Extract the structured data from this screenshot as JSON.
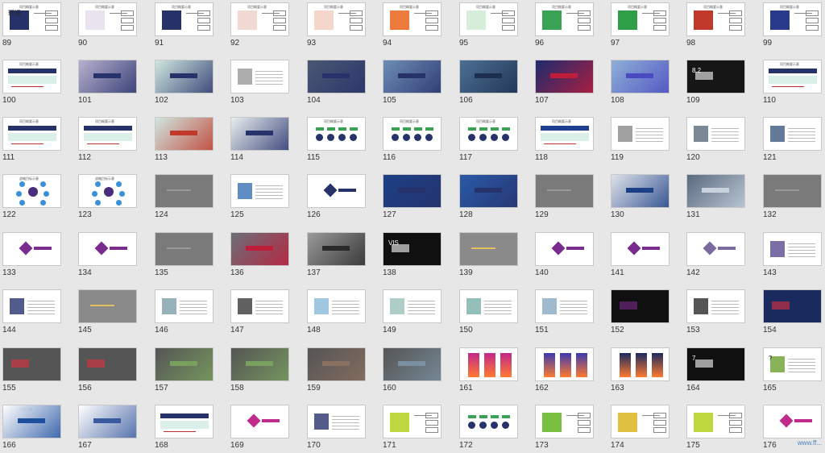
{
  "slides": [
    {
      "n": "89",
      "kind": "diagram",
      "bg": "#ffffff",
      "block": "#27326b",
      "cap": "环境",
      "title": "项目概要示意"
    },
    {
      "n": "90",
      "kind": "diagram",
      "bg": "#ffffff",
      "block": "#e9e2ef",
      "cap": "",
      "title": "项目概要示意"
    },
    {
      "n": "91",
      "kind": "diagram",
      "bg": "#ffffff",
      "block": "#27326b",
      "cap": "",
      "title": "项目概要示意"
    },
    {
      "n": "92",
      "kind": "diagram",
      "bg": "#ffffff",
      "block": "#f2d8d2",
      "cap": "",
      "title": "项目概要示意"
    },
    {
      "n": "93",
      "kind": "diagram",
      "bg": "#ffffff",
      "block": "#f4d6cb",
      "cap": "",
      "title": "项目概要示意"
    },
    {
      "n": "94",
      "kind": "diagram",
      "bg": "#ffffff",
      "block": "#ef7a3d",
      "cap": "",
      "title": "项目概要示意"
    },
    {
      "n": "95",
      "kind": "diagram",
      "bg": "#ffffff",
      "block": "#d7eedb",
      "cap": "",
      "title": "项目概要示意"
    },
    {
      "n": "96",
      "kind": "diagram",
      "bg": "#ffffff",
      "block": "#3aa254",
      "cap": "",
      "title": "项目概要示意"
    },
    {
      "n": "97",
      "kind": "diagram",
      "bg": "#ffffff",
      "block": "#2e9e47",
      "cap": "",
      "title": "项目概要示意"
    },
    {
      "n": "98",
      "kind": "diagram",
      "bg": "#ffffff",
      "block": "#c0392b",
      "cap": "",
      "title": "项目概要示意"
    },
    {
      "n": "99",
      "kind": "diagram",
      "bg": "#ffffff",
      "block": "#2a3a8a",
      "cap": "",
      "title": "项目概要示意"
    },
    {
      "n": "100",
      "kind": "banner",
      "bg": "#ffffff",
      "block": "#27326b",
      "cap": "",
      "title": "项目概要示意"
    },
    {
      "n": "101",
      "kind": "photo",
      "bg": "#b7b0cf",
      "block": "#27326b",
      "cap": "",
      "title": ""
    },
    {
      "n": "102",
      "kind": "photo",
      "bg": "#cfe7df",
      "block": "#27326b",
      "cap": "",
      "title": ""
    },
    {
      "n": "103",
      "kind": "text",
      "bg": "#ffffff",
      "block": "#999999",
      "cap": "",
      "title": ""
    },
    {
      "n": "104",
      "kind": "photo",
      "bg": "#4a5772",
      "block": "#27326b",
      "cap": "",
      "title": ""
    },
    {
      "n": "105",
      "kind": "photo",
      "bg": "#6d8db5",
      "block": "#27326b",
      "cap": "",
      "title": ""
    },
    {
      "n": "106",
      "kind": "photo",
      "bg": "#4c6f94",
      "block": "#1c2f4e",
      "cap": "",
      "title": ""
    },
    {
      "n": "107",
      "kind": "photo",
      "bg": "#1d2b6e",
      "block": "#c01d3a",
      "cap": "",
      "title": ""
    },
    {
      "n": "108",
      "kind": "photo",
      "bg": "#8fb0d8",
      "block": "#4a4ac0",
      "cap": "",
      "title": ""
    },
    {
      "n": "109",
      "kind": "dark",
      "bg": "#161616",
      "block": "#ffffff",
      "cap": "8.2",
      "title": ""
    },
    {
      "n": "110",
      "kind": "banner",
      "bg": "#ffffff",
      "block": "#27326b",
      "cap": "",
      "title": "项目概要示意"
    },
    {
      "n": "111",
      "kind": "banner",
      "bg": "#ffffff",
      "block": "#27326b",
      "cap": "",
      "title": "项目概要示意"
    },
    {
      "n": "112",
      "kind": "banner",
      "bg": "#ffffff",
      "block": "#27326b",
      "cap": "",
      "title": "项目概要示意"
    },
    {
      "n": "113",
      "kind": "photo",
      "bg": "#cfe6e0",
      "block": "#c0392b",
      "cap": "",
      "title": ""
    },
    {
      "n": "114",
      "kind": "photo",
      "bg": "#e8eef0",
      "block": "#27326b",
      "cap": "",
      "title": ""
    },
    {
      "n": "115",
      "kind": "circles",
      "bg": "#ffffff",
      "block": "#27326b",
      "cap": "",
      "title": "项目概要示意"
    },
    {
      "n": "116",
      "kind": "circles",
      "bg": "#ffffff",
      "block": "#27326b",
      "cap": "",
      "title": "项目概要示意"
    },
    {
      "n": "117",
      "kind": "circles",
      "bg": "#ffffff",
      "block": "#27326b",
      "cap": "",
      "title": "项目概要示意"
    },
    {
      "n": "118",
      "kind": "banner",
      "bg": "#ffffff",
      "block": "#1e3f8f",
      "cap": "",
      "title": "项目概要示意"
    },
    {
      "n": "119",
      "kind": "text",
      "bg": "#ffffff",
      "block": "#8a8a8a",
      "cap": "",
      "title": ""
    },
    {
      "n": "120",
      "kind": "text",
      "bg": "#ffffff",
      "block": "#5a6a7a",
      "cap": "",
      "title": ""
    },
    {
      "n": "121",
      "kind": "text",
      "bg": "#ffffff",
      "block": "#3c5a80",
      "cap": "",
      "title": ""
    },
    {
      "n": "122",
      "kind": "hub",
      "bg": "#ffffff",
      "block": "#4a2c7e",
      "cap": "",
      "title": "战略目标示意"
    },
    {
      "n": "123",
      "kind": "hub",
      "bg": "#ffffff",
      "block": "#4a2c7e",
      "cap": "",
      "title": "战略目标示意"
    },
    {
      "n": "124",
      "kind": "gray",
      "bg": "#7a7a7a",
      "block": "#9a9a9a",
      "cap": "",
      "title": ""
    },
    {
      "n": "125",
      "kind": "text",
      "bg": "#ffffff",
      "block": "#3a6fb5",
      "cap": "",
      "title": ""
    },
    {
      "n": "126",
      "kind": "logo",
      "bg": "#ffffff",
      "block": "#27326b",
      "cap": "",
      "title": ""
    },
    {
      "n": "127",
      "kind": "photo",
      "bg": "#1c3f86",
      "block": "#27326b",
      "cap": "",
      "title": ""
    },
    {
      "n": "128",
      "kind": "photo",
      "bg": "#2a5aa8",
      "block": "#27326b",
      "cap": "",
      "title": ""
    },
    {
      "n": "129",
      "kind": "gray",
      "bg": "#7a7a7a",
      "block": "#9a9a9a",
      "cap": "",
      "title": ""
    },
    {
      "n": "130",
      "kind": "photo",
      "bg": "#dfe3ea",
      "block": "#1c3f86",
      "cap": "",
      "title": ""
    },
    {
      "n": "131",
      "kind": "photo",
      "bg": "#5a6a80",
      "block": "#c9d3df",
      "cap": "",
      "title": ""
    },
    {
      "n": "132",
      "kind": "gray",
      "bg": "#7a7a7a",
      "block": "#9a9a9a",
      "cap": "",
      "title": ""
    },
    {
      "n": "133",
      "kind": "logo",
      "bg": "#ffffff",
      "block": "#7a2c8e",
      "cap": "",
      "title": ""
    },
    {
      "n": "134",
      "kind": "logo",
      "bg": "#ffffff",
      "block": "#7a2c8e",
      "cap": "",
      "title": ""
    },
    {
      "n": "135",
      "kind": "gray",
      "bg": "#7a7a7a",
      "block": "#9a9a9a",
      "cap": "",
      "title": ""
    },
    {
      "n": "136",
      "kind": "photo",
      "bg": "#6b6f78",
      "block": "#c01d3a",
      "cap": "",
      "title": ""
    },
    {
      "n": "137",
      "kind": "photo",
      "bg": "#9a9a9a",
      "block": "#2a2a2a",
      "cap": "",
      "title": ""
    },
    {
      "n": "138",
      "kind": "dark",
      "bg": "#101010",
      "block": "#ffffff",
      "cap": "VIS",
      "title": ""
    },
    {
      "n": "139",
      "kind": "gray",
      "bg": "#8a8a8a",
      "block": "#e0c060",
      "cap": "",
      "title": ""
    },
    {
      "n": "140",
      "kind": "logo",
      "bg": "#ffffff",
      "block": "#7a2c8e",
      "cap": "",
      "title": ""
    },
    {
      "n": "141",
      "kind": "logo",
      "bg": "#ffffff",
      "block": "#7a2c8e",
      "cap": "",
      "title": ""
    },
    {
      "n": "142",
      "kind": "logo",
      "bg": "#ffffff",
      "block": "#7a6a9e",
      "cap": "",
      "title": ""
    },
    {
      "n": "143",
      "kind": "text",
      "bg": "#ffffff",
      "block": "#5a4a8e",
      "cap": "",
      "title": ""
    },
    {
      "n": "144",
      "kind": "text",
      "bg": "#ffffff",
      "block": "#27326b",
      "cap": "",
      "title": ""
    },
    {
      "n": "145",
      "kind": "gray",
      "bg": "#8a8a8a",
      "block": "#e0c060",
      "cap": "",
      "title": ""
    },
    {
      "n": "146",
      "kind": "text",
      "bg": "#ffffff",
      "block": "#7aa0a8",
      "cap": "",
      "title": ""
    },
    {
      "n": "147",
      "kind": "text",
      "bg": "#ffffff",
      "block": "#3a3a3a",
      "cap": "",
      "title": ""
    },
    {
      "n": "148",
      "kind": "text",
      "bg": "#ffffff",
      "block": "#8ab8d8",
      "cap": "",
      "title": ""
    },
    {
      "n": "149",
      "kind": "text",
      "bg": "#ffffff",
      "block": "#9ac0b8",
      "cap": "",
      "title": ""
    },
    {
      "n": "150",
      "kind": "text",
      "bg": "#ffffff",
      "block": "#7ab0a8",
      "cap": "",
      "title": ""
    },
    {
      "n": "151",
      "kind": "text",
      "bg": "#ffffff",
      "block": "#8aa8c0",
      "cap": "",
      "title": ""
    },
    {
      "n": "152",
      "kind": "dark",
      "bg": "#101010",
      "block": "#7a2c8e",
      "cap": "",
      "title": ""
    },
    {
      "n": "153",
      "kind": "text",
      "bg": "#ffffff",
      "block": "#2a2a2a",
      "cap": "",
      "title": ""
    },
    {
      "n": "154",
      "kind": "dark",
      "bg": "#1b2a5e",
      "block": "#e03040",
      "cap": "",
      "title": ""
    },
    {
      "n": "155",
      "kind": "dark",
      "bg": "#555555",
      "block": "#e03040",
      "cap": "",
      "title": ""
    },
    {
      "n": "156",
      "kind": "dark",
      "bg": "#555555",
      "block": "#e03040",
      "cap": "",
      "title": ""
    },
    {
      "n": "157",
      "kind": "photo",
      "bg": "#555555",
      "block": "#7aa060",
      "cap": "",
      "title": ""
    },
    {
      "n": "158",
      "kind": "photo",
      "bg": "#555555",
      "block": "#7aa060",
      "cap": "",
      "title": ""
    },
    {
      "n": "159",
      "kind": "photo",
      "bg": "#555555",
      "block": "#8a7060",
      "cap": "",
      "title": ""
    },
    {
      "n": "160",
      "kind": "photo",
      "bg": "#555555",
      "block": "#7a90a0",
      "cap": "",
      "title": ""
    },
    {
      "n": "161",
      "kind": "posters",
      "bg": "#ffffff",
      "block": "#c02a8a",
      "cap": "",
      "title": ""
    },
    {
      "n": "162",
      "kind": "posters",
      "bg": "#ffffff",
      "block": "#3a3ab0",
      "cap": "",
      "title": ""
    },
    {
      "n": "163",
      "kind": "posters",
      "bg": "#ffffff",
      "block": "#1b2a5e",
      "cap": "",
      "title": ""
    },
    {
      "n": "164",
      "kind": "dark",
      "bg": "#101010",
      "block": "#ffffff",
      "cap": "7",
      "title": ""
    },
    {
      "n": "165",
      "kind": "text",
      "bg": "#ffffff",
      "block": "#6aa030",
      "cap": "?",
      "title": ""
    },
    {
      "n": "166",
      "kind": "photo",
      "bg": "#ffffff",
      "block": "#1e4f9f",
      "cap": "",
      "title": "中国日报"
    },
    {
      "n": "167",
      "kind": "photo",
      "bg": "#ffffff",
      "block": "#3a5a9f",
      "cap": "",
      "title": ""
    },
    {
      "n": "168",
      "kind": "banner",
      "bg": "#ffffff",
      "block": "#27326b",
      "cap": "",
      "title": ""
    },
    {
      "n": "169",
      "kind": "logo",
      "bg": "#ffffff",
      "block": "#c02a8a",
      "cap": "",
      "title": ""
    },
    {
      "n": "170",
      "kind": "text",
      "bg": "#ffffff",
      "block": "#27326b",
      "cap": "",
      "title": ""
    },
    {
      "n": "171",
      "kind": "diagram",
      "bg": "#ffffff",
      "block": "#c0d840",
      "cap": "",
      "title": ""
    },
    {
      "n": "172",
      "kind": "circles",
      "bg": "#ffffff",
      "block": "#27326b",
      "cap": "",
      "title": ""
    },
    {
      "n": "173",
      "kind": "diagram",
      "bg": "#ffffff",
      "block": "#7ac040",
      "cap": "",
      "title": ""
    },
    {
      "n": "174",
      "kind": "diagram",
      "bg": "#ffffff",
      "block": "#e0c040",
      "cap": "",
      "title": ""
    },
    {
      "n": "175",
      "kind": "diagram",
      "bg": "#ffffff",
      "block": "#c0d840",
      "cap": "",
      "title": ""
    },
    {
      "n": "176",
      "kind": "logo",
      "bg": "#ffffff",
      "block": "#c02a8a",
      "cap": "",
      "title": ""
    }
  ],
  "watermark": "www.ff..."
}
